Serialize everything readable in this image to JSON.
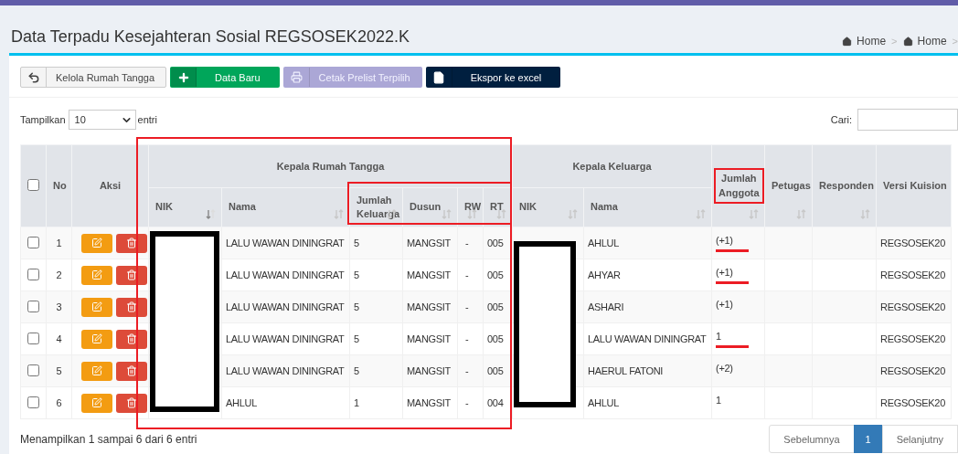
{
  "page_title": "Data Terpadu Kesejahteran Sosial REGSOSEK2022.K",
  "breadcrumb": {
    "separator": ">",
    "items": [
      {
        "label": "Home"
      },
      {
        "label": "Home"
      }
    ]
  },
  "toolbar": [
    {
      "kind": "back",
      "label": "Kelola Rumah Tangga",
      "disabled": false
    },
    {
      "kind": "add",
      "label": "Data Baru",
      "disabled": false
    },
    {
      "kind": "print",
      "label": "Cetak Prelist Terpilih",
      "disabled": true
    },
    {
      "kind": "export",
      "label": "Ekspor ke excel",
      "disabled": false
    }
  ],
  "length_control": {
    "label_before": "Tampilkan",
    "value": "10",
    "label_after": "entri"
  },
  "search": {
    "label": "Cari:"
  },
  "columns": [
    {
      "kind": "checkbox",
      "checked": false
    },
    {
      "kind": "single",
      "label": "No",
      "sortable": false,
      "highlighted": false
    },
    {
      "kind": "single",
      "label": "Aksi",
      "sortable": false,
      "highlighted": false
    },
    {
      "kind": "group",
      "label": "Kepala Rumah Tangga",
      "children": [
        {
          "label": "NIK",
          "sorted": true
        },
        {
          "label": "Nama",
          "sorted": false
        },
        {
          "label": "Jumlah Keluarga",
          "sorted": false
        },
        {
          "label": "Dusun",
          "sorted": false
        },
        {
          "label": "RW",
          "sorted": false
        },
        {
          "label": "RT",
          "sorted": false
        }
      ]
    },
    {
      "kind": "group",
      "label": "Kepala Keluarga",
      "children": [
        {
          "label": "NIK",
          "sorted": false
        },
        {
          "label": "Nama",
          "sorted": false
        }
      ]
    },
    {
      "kind": "single",
      "label": "Jumlah Anggota",
      "sortable": true,
      "highlighted": true
    },
    {
      "kind": "single",
      "label": "Petugas",
      "sortable": true,
      "highlighted": false
    },
    {
      "kind": "single",
      "label": "Responden",
      "sortable": true,
      "highlighted": false
    },
    {
      "kind": "single",
      "label": "Versi Kuision",
      "sortable": false,
      "highlighted": false
    }
  ],
  "rows": [
    {
      "checked": false,
      "no": "1",
      "krt_nama": "LALU WAWAN DININGRAT",
      "jumlah_keluarga": "5",
      "dusun": "MANGSIT",
      "rw": "-",
      "rt": "005",
      "kk_nama": "AHLUL",
      "jumlah_anggota": "(+1)",
      "underlined": true,
      "versi": "REGSOSEK20"
    },
    {
      "checked": false,
      "no": "2",
      "krt_nama": "LALU WAWAN DININGRAT",
      "jumlah_keluarga": "5",
      "dusun": "MANGSIT",
      "rw": "-",
      "rt": "005",
      "kk_nama": "AHYAR",
      "jumlah_anggota": "(+1)",
      "underlined": true,
      "versi": "REGSOSEK20"
    },
    {
      "checked": false,
      "no": "3",
      "krt_nama": "LALU WAWAN DININGRAT",
      "jumlah_keluarga": "5",
      "dusun": "MANGSIT",
      "rw": "-",
      "rt": "005",
      "kk_nama": "ASHARI",
      "jumlah_anggota": "(+1)",
      "underlined": false,
      "versi": "REGSOSEK20"
    },
    {
      "checked": false,
      "no": "4",
      "krt_nama": "LALU WAWAN DININGRAT",
      "jumlah_keluarga": "5",
      "dusun": "MANGSIT",
      "rw": "-",
      "rt": "005",
      "kk_nama": "LALU WAWAN DININGRAT",
      "jumlah_anggota": "1",
      "underlined": true,
      "versi": "REGSOSEK20"
    },
    {
      "checked": false,
      "no": "5",
      "krt_nama": "LALU WAWAN DININGRAT",
      "jumlah_keluarga": "5",
      "dusun": "MANGSIT",
      "rw": "-",
      "rt": "005",
      "kk_nama": "HAERUL FATONI",
      "jumlah_anggota": "(+2)",
      "underlined": false,
      "versi": "REGSOSEK20"
    },
    {
      "checked": false,
      "no": "6",
      "krt_nama": "AHLUL",
      "jumlah_keluarga": "1",
      "dusun": "MANGSIT",
      "rw": "-",
      "rt": "004",
      "kk_nama": "AHLUL",
      "jumlah_anggota": "1",
      "underlined": false,
      "versi": "REGSOSEK20"
    }
  ],
  "info": "Menampilkan 1 sampai 6 dari 6 entri",
  "pagination": [
    {
      "label": "Sebelumnya",
      "selected": false
    },
    {
      "label": "1",
      "selected": true
    },
    {
      "label": "Selanjutny",
      "selected": false
    }
  ]
}
